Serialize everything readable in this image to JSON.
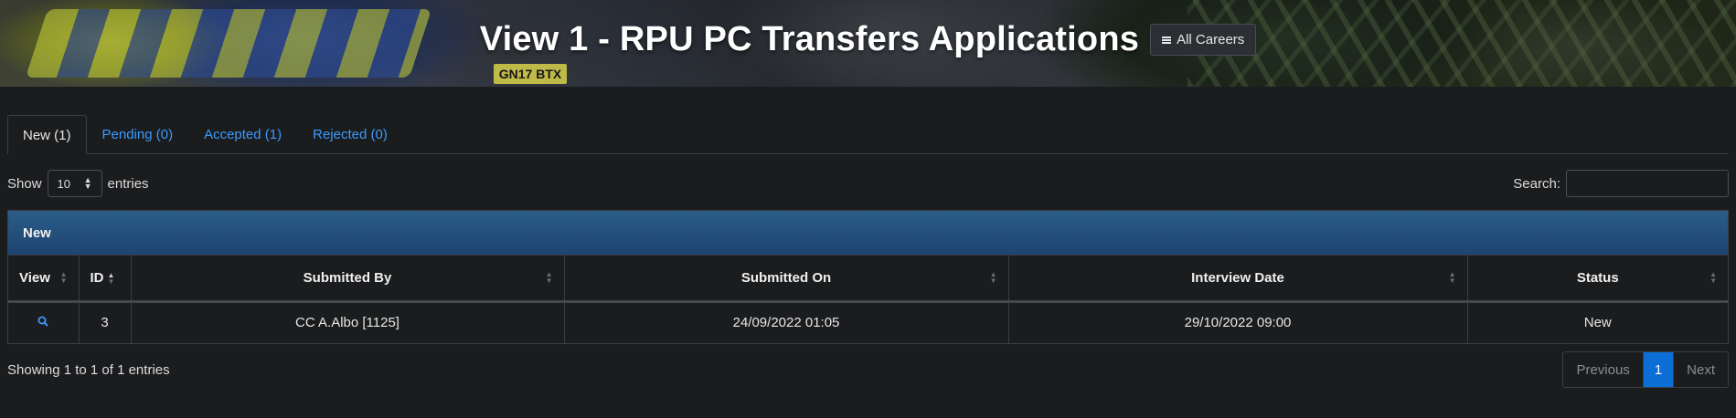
{
  "header": {
    "title": "View 1 - RPU PC Transfers Applications",
    "careers_button": "All Careers",
    "plate_text": "GN17 BTX"
  },
  "tabs": [
    {
      "label": "New (1)",
      "active": true
    },
    {
      "label": "Pending (0)",
      "active": false
    },
    {
      "label": "Accepted (1)",
      "active": false
    },
    {
      "label": "Rejected (0)",
      "active": false
    }
  ],
  "controls": {
    "show_label": "Show",
    "entries_value": "10",
    "entries_label": "entries",
    "search_label": "Search:",
    "search_value": ""
  },
  "panel": {
    "title": "New",
    "columns": [
      "View",
      "ID",
      "Submitted By",
      "Submitted On",
      "Interview Date",
      "Status"
    ],
    "rows": [
      {
        "id": "3",
        "submitted_by": "CC A.Albo [1125]",
        "submitted_on": "24/09/2022 01:05",
        "interview_date": "29/10/2022 09:00",
        "status": "New"
      }
    ]
  },
  "footer": {
    "info": "Showing 1 to 1 of 1 entries",
    "previous": "Previous",
    "page": "1",
    "next": "Next"
  },
  "colors": {
    "link": "#3a9bff",
    "panel_header": "#1d4470",
    "active_page": "#0d6ed6",
    "background": "#1b1c1e"
  }
}
